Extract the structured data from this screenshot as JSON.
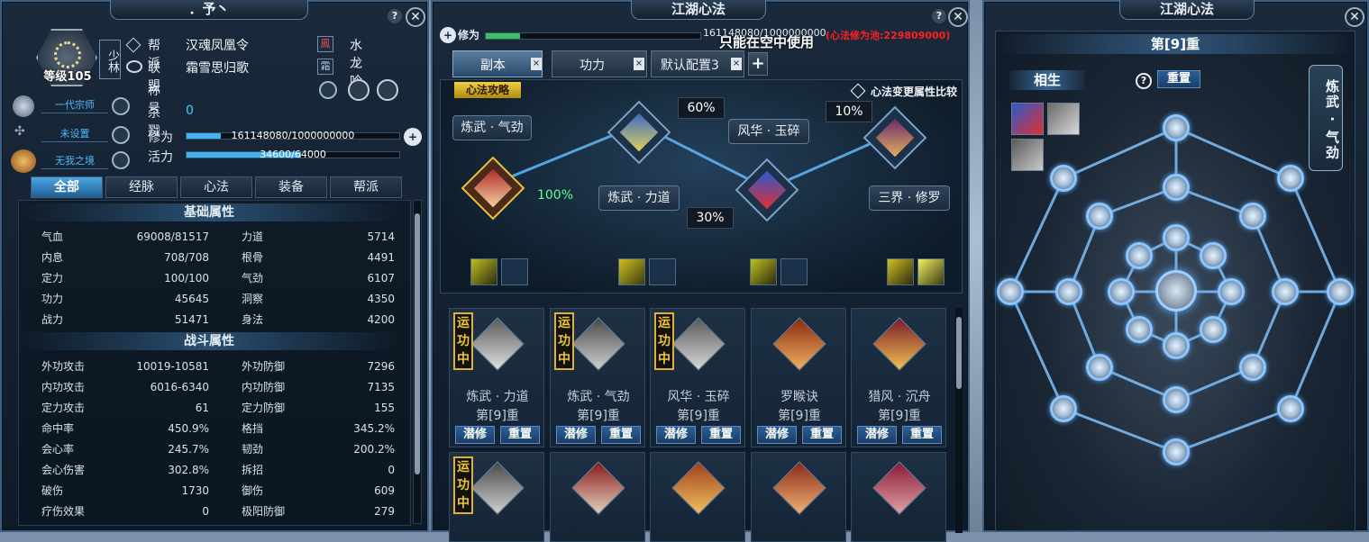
{
  "left_panel": {
    "title": "．予丶",
    "level": "等级105",
    "sect_tag": "少林",
    "rows": [
      {
        "label": "帮派",
        "value": "汉魂凤凰令",
        "badge": "鳳",
        "extra": "水龙吟"
      },
      {
        "label": "联盟",
        "value": "霜雪思归歌",
        "badge": "霜"
      },
      {
        "label": "称号",
        "value": ""
      },
      {
        "label": "杀戮",
        "value": "0"
      }
    ],
    "titles": [
      "一代宗师",
      "未设置",
      "无我之境"
    ],
    "xiuwei": {
      "label": "修为",
      "text": "161148080/1000000000",
      "progress": 0.16
    },
    "huoli": {
      "label": "活力",
      "text": "34600/64000",
      "progress": 0.54
    },
    "tabs": [
      "全部",
      "经脉",
      "心法",
      "装备",
      "帮派"
    ],
    "basic_header": "基础属性",
    "basic": [
      [
        "气血",
        "69008/81517",
        "力道",
        "5714"
      ],
      [
        "内息",
        "708/708",
        "根骨",
        "4491"
      ],
      [
        "定力",
        "100/100",
        "气劲",
        "6107"
      ],
      [
        "功力",
        "45645",
        "洞察",
        "4350"
      ],
      [
        "战力",
        "51471",
        "身法",
        "4200"
      ]
    ],
    "combat_header": "战斗属性",
    "combat": [
      [
        "外功攻击",
        "10019-10581",
        "外功防御",
        "7296"
      ],
      [
        "内功攻击",
        "6016-6340",
        "内功防御",
        "7135"
      ],
      [
        "定力攻击",
        "61",
        "定力防御",
        "155"
      ],
      [
        "命中率",
        "450.9%",
        "格挡",
        "345.2%"
      ],
      [
        "会心率",
        "245.7%",
        "韧劲",
        "200.2%"
      ],
      [
        "会心伤害",
        "302.8%",
        "拆招",
        "0"
      ],
      [
        "破伤",
        "1730",
        "御伤",
        "609"
      ],
      [
        "疗伤效果",
        "0",
        "极阳防御",
        "279"
      ]
    ]
  },
  "mid_panel": {
    "title": "江湖心法",
    "xiuwei_label": "修为",
    "xiuwei_text": "161148080/1000000000",
    "pool_text": "(心法修为池:229809000)",
    "overlay_text": "只能在空中使用",
    "tabs": [
      "副本",
      "功力",
      "默认配置3"
    ],
    "tab_close": "×",
    "add_tab": "+",
    "guide_button": "心法攻略",
    "compare_label": "心法变更属性比较",
    "chips": [
      "炼武 · 气劲",
      "炼武 · 力道",
      "风华 · 玉碎",
      "三界 · 修罗"
    ],
    "percents": [
      "100%",
      "60%",
      "30%",
      "10%"
    ],
    "cards": [
      {
        "name": "炼武 · 力道",
        "level": "第[9]重",
        "active": "运功中"
      },
      {
        "name": "炼武 · 气劲",
        "level": "第[9]重",
        "active": "运功中"
      },
      {
        "name": "风华 · 玉碎",
        "level": "第[9]重",
        "active": "运功中"
      },
      {
        "name": "罗睺诀",
        "level": "第[9]重",
        "active": ""
      },
      {
        "name": "猎风 · 沉舟",
        "level": "第[9]重",
        "active": ""
      }
    ],
    "card_buttons": [
      "潜修",
      "重置"
    ],
    "second_row_active": "运功中"
  },
  "right_panel": {
    "title": "江湖心法",
    "level_title": "第[9]重",
    "xiangsheng": "相生",
    "reset": "重置",
    "help": "?",
    "side_label": "炼武 · 气劲"
  },
  "colors": {
    "accent": "#3fb4f0",
    "gold": "#f1c630",
    "pool_red": "#ff2020",
    "panel_border": "#3f5f80"
  }
}
